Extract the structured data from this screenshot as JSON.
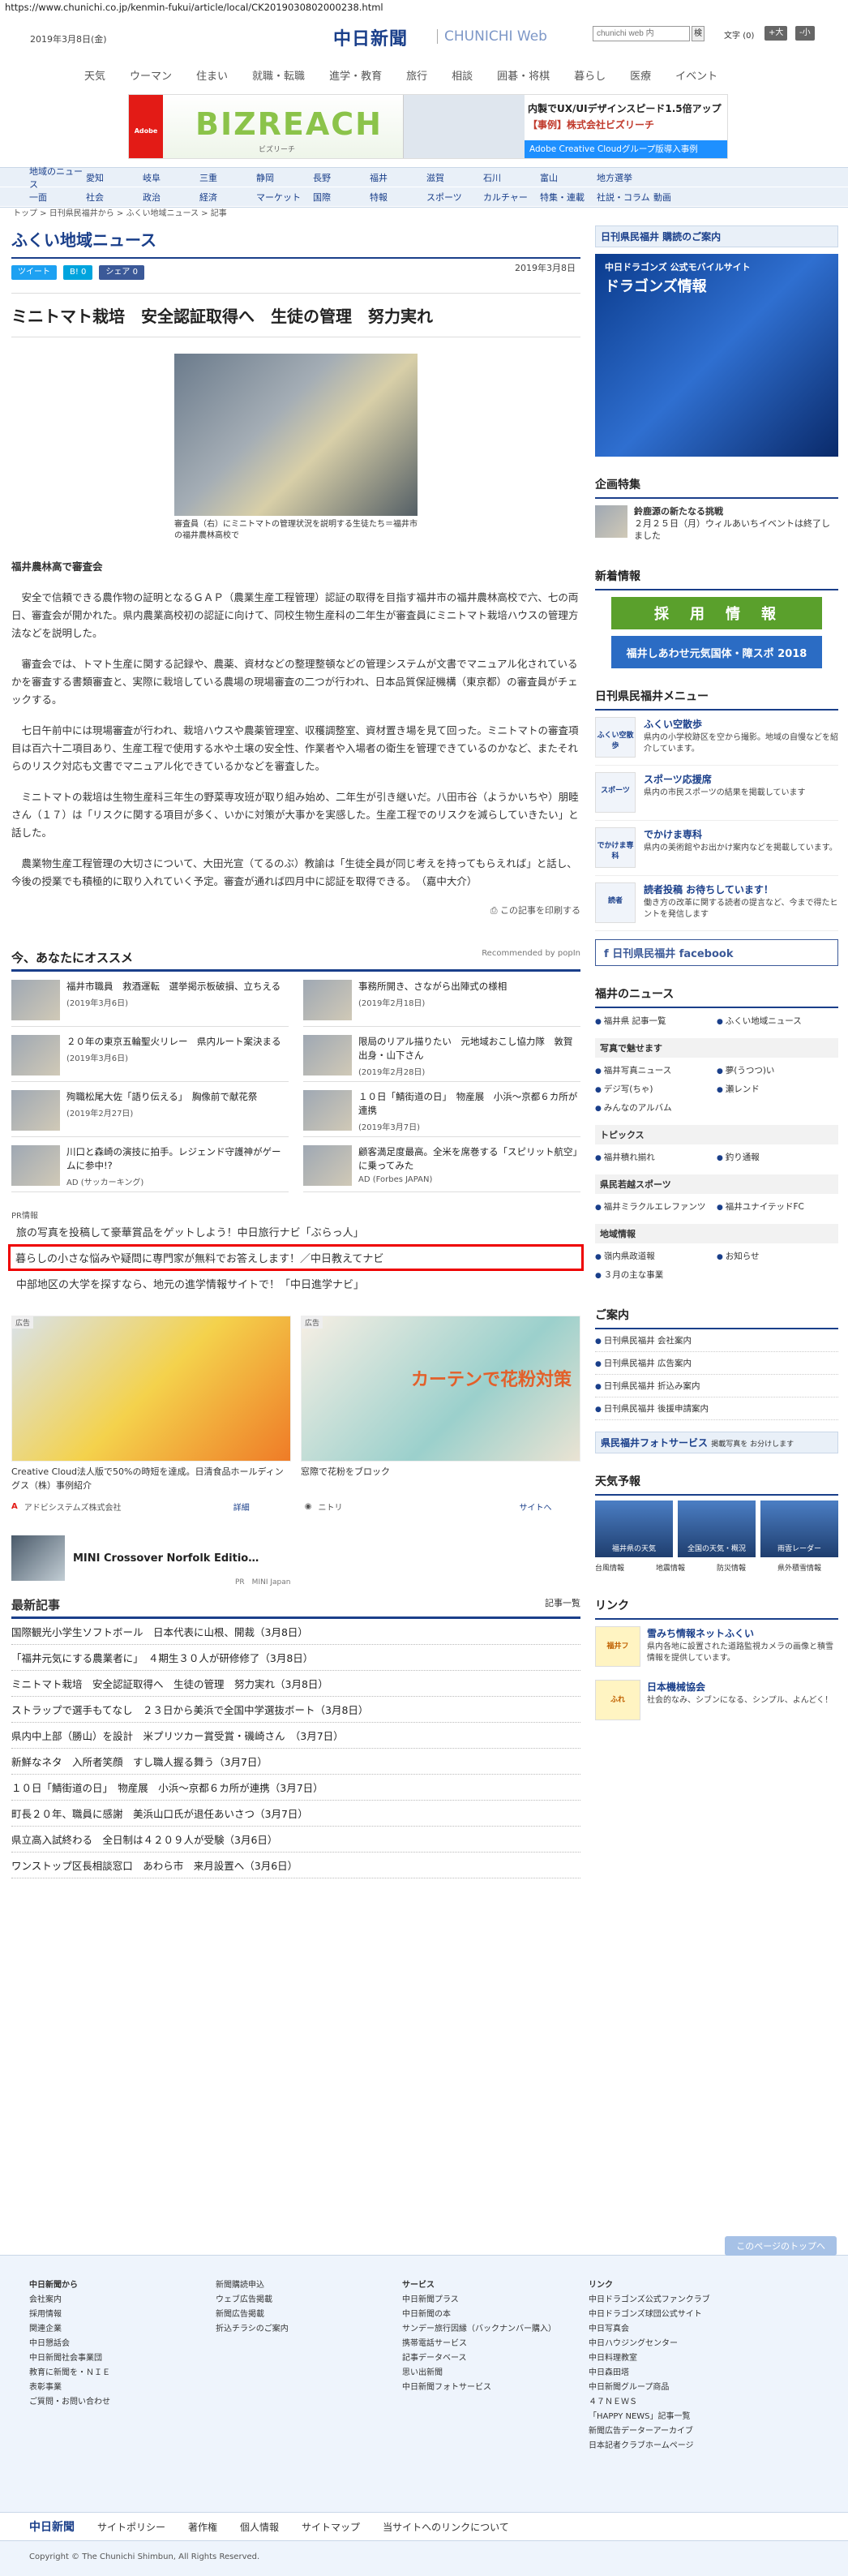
{
  "url": "https://www.chunichi.co.jp/kenmin-fukui/article/local/CK2019030802000238.html",
  "header": {
    "date": "2019年3月8日(金)",
    "logo": "中日新聞",
    "logo_en": "CHUNICHI Web",
    "search_placeholder": "chunichi web 内",
    "search_btn": "検",
    "font_label": "文字",
    "font_zero": "(0)",
    "font_plus": "+大",
    "font_minus": "-小"
  },
  "topnav": [
    "天気",
    "ウーマン",
    "住まい",
    "就職・転職",
    "進学・教育",
    "旅行",
    "相談",
    "囲碁・将棋",
    "暮らし",
    "医療",
    "イベント"
  ],
  "ad_top": {
    "adobe": "Adobe",
    "brand": "BIZREACH",
    "reach": "ビズリーチ",
    "line1": "内製でUX/UIデザインスピード1.5倍アップ",
    "line2": "【事例】株式会社ビズリーチ",
    "line3": "Adobe Creative Cloudグループ版導入事例"
  },
  "catnav": {
    "row1": [
      "地域のニュース",
      "愛知",
      "岐阜",
      "三重",
      "静岡",
      "長野",
      "福井",
      "滋賀",
      "石川",
      "富山",
      "地方選挙"
    ],
    "row2": [
      "一面",
      "社会",
      "政治",
      "経済",
      "マーケット",
      "国際",
      "特報",
      "スポーツ",
      "カルチャー",
      "特集・連載",
      "社説・コラム",
      "動画"
    ]
  },
  "breadcrumb": "トップ > 日刊県民福井から > ふくい地域ニュース > 記事",
  "page_title": "ふくい地域ニュース",
  "share": {
    "tweet": "ツイート",
    "hatena": "B! 0",
    "facebook": "シェア 0"
  },
  "article": {
    "date": "2019年3月8日",
    "headline": "ミニトマト栽培　安全認証取得へ　生徒の管理　努力実れ",
    "caption": "審査員（右）にミニトマトの管理状況を説明する生徒たち＝福井市の福井農林高校で",
    "subhead": "福井農林高で審査会",
    "paragraphs": [
      "安全で信頼できる農作物の証明となるＧＡＰ（農業生産工程管理）認証の取得を目指す福井市の福井農林高校で六、七の両日、審査会が開かれた。県内農業高校初の認証に向けて、同校生物生産科の二年生が審査員にミニトマト栽培ハウスの管理方法などを説明した。",
      "審査会では、トマト生産に関する記録や、農薬、資材などの整理整頓などの管理システムが文書でマニュアル化されているかを審査する書類審査と、実際に栽培している農場の現場審査の二つが行われ、日本品質保証機構（東京都）の審査員がチェックする。",
      "七日午前中には現場審査が行われ、栽培ハウスや農薬管理室、収穫調整室、資材置き場を見て回った。ミニトマトの審査項目は百六十二項目あり、生産工程で使用する水や土壌の安全性、作業者や入場者の衛生を管理できているのかなど、またそれらのリスク対応も文書でマニュアル化できているかなどを審査した。",
      "ミニトマトの栽培は生物生産科三年生の野菜専攻班が取り組み始め、二年生が引き継いだ。八田市谷（ようかいちや）朋睦さん（１７）は「リスクに関する項目が多く、いかに対策が大事かを実感した。生産工程でのリスクを減らしていきたい」と話した。",
      "農業物生産工程管理の大切さについて、大田光宣（てるのぶ）教諭は「生徒全員が同じ考えを持ってもらえれば」と話し、今後の授業でも積極的に取り入れていく予定。審査が通れば四月中に認証を取得できる。　（嘉中大介）"
    ],
    "print": "この記事を印刷する"
  },
  "recommend": {
    "title": "今、あなたにオススメ",
    "by": "Recommended by popIn",
    "items": [
      {
        "title": "福井市職員　救酒運転　選挙掲示板破損、立ちえる",
        "date": "(2019年3月6日)"
      },
      {
        "title": "事務所開き、さながら出陣式の様相",
        "date": "(2019年2月18日)"
      },
      {
        "title": "２０年の東京五輪聖火リレー　県内ルート案決まる",
        "date": "(2019年3月6日)"
      },
      {
        "title": "限局のリアル描りたい　元地域おこし協力隊　敦賀出身・山下さん",
        "date": "(2019年2月28日)"
      },
      {
        "title": "殉職松尾大佐「語り伝える」　胸像前で献花祭",
        "date": "(2019年2月27日)"
      },
      {
        "title": "１０日「鯖街道の日」　物産展　小浜〜京都６カ所が連携",
        "date": "(2019年3月7日)"
      },
      {
        "title": "川口と森崎の演技に拍手。レジェンド守護神がゲームに参中!?",
        "date": "AD (サッカーキング)"
      },
      {
        "title": "顧客満足度最高。全米を席巻する「スピリット航空」に乗ってみた",
        "date": "AD (Forbes JAPAN)"
      }
    ]
  },
  "pr": {
    "label": "PR情報",
    "items": [
      "旅の写真を投稿して豪華賞品をゲットしよう！中日旅行ナビ「ぶらっ人」",
      "暮らしの小さな悩みや疑問に専門家が無料でお答えします！／中日教えてナビ",
      "中部地区の大学を探すなら、地元の進学情報サイトで！「中日進学ナビ」"
    ]
  },
  "ads2": {
    "badge": "広告",
    "curtain": "カーテンで花粉対策",
    "cap_a": "Creative Cloud法人版で50%の時短を達成。日清食品ホールディングス（株）事例紹介",
    "cap_b": "窓際で花粉をブロック",
    "src_a": "アドビシステムズ株式会社",
    "src_a_tag": "詳細",
    "src_b": "ニトリ",
    "src_b_tag": "サイトへ"
  },
  "mini": {
    "title": "MINI Crossover Norfolk Editio…",
    "pr": "PR　MINI Japan"
  },
  "latest": {
    "title": "最新記事",
    "all": "記事一覧",
    "items": [
      "国際観光小学生ソフトボール　日本代表に山根、開裁（3月8日）",
      "「福井元気にする農業者に」　４期生３０人が研修修了（3月8日）",
      "ミニトマト栽培　安全認証取得へ　生徒の管理　努力実れ（3月8日）",
      "ストラップで選手もてなし　２３日から美浜で全国中学選抜ボート（3月8日）",
      "県内中上部（勝山）を設計　米プリツカー賞受賞・磯崎さん　（3月7日）",
      "新鮮なネタ　入所者笑顔　すし職人握る舞う（3月7日）",
      "１０日「鯖街道の日」　物産展　小浜〜京都６カ所が連携（3月7日）",
      "町長２０年、職員に感謝　美浜山口氏が退任あいさつ（3月7日）",
      "県立高入試終わる　全日制は４２０９人が受験（3月6日）",
      "ワンストップ区長相談窓口　あわら市　来月設置へ（3月6日）"
    ]
  },
  "side": {
    "subscribe": "日刊県民福井 購読のご案内",
    "dragons_a": "中日ドラゴンズ 公式モバイルサイト",
    "dragons_b": "ドラゴンズ情報",
    "feature_title": "企画特集",
    "feature_item": "鈴鹿源の新たなる挑戦",
    "feature_desc": "２月２５日（月）ウィルあいちイベントは終了しました",
    "news_info": "新着情報",
    "recruit": "採　用　情　報",
    "kokutai": "福井しあわせ元気国体・障スポ 2018",
    "menu_title": "日刊県民福井メニュー",
    "menu": [
      {
        "icon": "ふくい空散歩",
        "title": "ふくい空散歩",
        "desc": "県内の小学校跡区を空から撮影。地域の自慢などを紹介しています。"
      },
      {
        "icon": "スポーツ",
        "title": "スポーツ応援席",
        "desc": "県内の市民スポーツの結果を掲載しています"
      },
      {
        "icon": "でかけま専科",
        "title": "でかけま専科",
        "desc": "県内の美術館やお出かけ案内などを掲載しています。"
      },
      {
        "icon": "読者",
        "title": "読者投稿 お待ちしています！",
        "desc": "働き方の改革に関する読者の提言など、今まで得たヒントを発信します"
      }
    ],
    "facebook": "日刊県民福井 facebook",
    "fukui_news": "福井のニュース",
    "fukui_links": [
      "福井県 記事一覧",
      "ふくい地域ニュース"
    ],
    "photo_sub": "写真で魅せます",
    "photo_links": [
      "福井写真ニュース",
      "夢(うつつ)い",
      "デジ写(ちゃ)",
      "瀬レンド",
      "みんなのアルバム"
    ],
    "topics_sub": "トピックス",
    "topics": [
      "福井積れ揃れ",
      "釣り通報"
    ],
    "sports_sub": "県民若越スポーツ",
    "sports": [
      "福井ミラクルエレファンツ",
      "福井ユナイテッドFC"
    ],
    "area_sub": "地域情報",
    "area": [
      "嶺内県政道報",
      "お知らせ",
      "３月の主な事業"
    ],
    "guide_title": "ご案内",
    "guide": [
      "日刊県民福井 会社案内",
      "日刊県民福井 広告案内",
      "日刊県民福井 折込み案内",
      "日刊県民福井 後援申請案内"
    ],
    "photo_service": "県民福井フォトサービス",
    "photo_service_sub": "掲載写真を お分けします",
    "weather_title": "天気予報",
    "weather": [
      "福井県の天気",
      "全国の天気・概況",
      "雨雲レーダー"
    ],
    "weather_links": [
      "台風情報",
      "地震情報",
      "防災情報",
      "県外積雪情報"
    ],
    "link_title": "リンク",
    "links": [
      {
        "icon": "福井フ",
        "title": "雪みち情報ネットふくい",
        "desc": "県内各地に設置された道路監視カメラの画像と積雪情報を提供しています。"
      },
      {
        "icon": "ふれ",
        "title": "日本機械協会",
        "desc": "社会的なみ、シブンになる、シンプル、よんどく！"
      }
    ]
  },
  "footer": {
    "totop": "このページのトップへ",
    "cols": [
      {
        "head": "中日新聞から",
        "items": [
          "会社案内",
          "採用情報",
          "関連企業",
          "中日懇話会",
          "中日新聞社会事業団",
          "教育に新聞を・ＮＩＥ",
          "表彰事業",
          "ご質問・お問い合わせ"
        ]
      },
      {
        "head": "",
        "items": [
          "新聞購読申込",
          "ウェブ広告掲載",
          "新聞広告掲載",
          "折込チラシのご案内"
        ]
      },
      {
        "head": "サービス",
        "items": [
          "中日新聞プラス",
          "中日新聞の本",
          "サンデー旅行因縁（バックナンバー購入）",
          "携帯電話サービス",
          "記事データベース",
          "思い出新聞",
          "中日新聞フォトサービス"
        ]
      },
      {
        "head": "リンク",
        "items": [
          "中日ドラゴンズ公式ファンクラブ",
          "中日ドラゴンズ球団公式サイト",
          "中日写真会",
          "中日ハウジングセンター",
          "中日料理教室",
          "中日森田塔",
          "中日新聞グループ商品",
          "４７ＮＥＷＳ",
          "「HAPPY NEWS」記事一覧",
          "新聞広告データーアーカイブ",
          "日本記者クラブホームページ"
        ]
      }
    ],
    "logo": "中日新聞",
    "bar": [
      "サイトポリシー",
      "著作権",
      "個人情報",
      "サイトマップ",
      "当サイトへのリンクについて"
    ],
    "copyright": "Copyright © The Chunichi Shimbun, All Rights Reserved."
  },
  "colors": {
    "brand": "#1a3f8a",
    "highlight": "#e00000"
  }
}
